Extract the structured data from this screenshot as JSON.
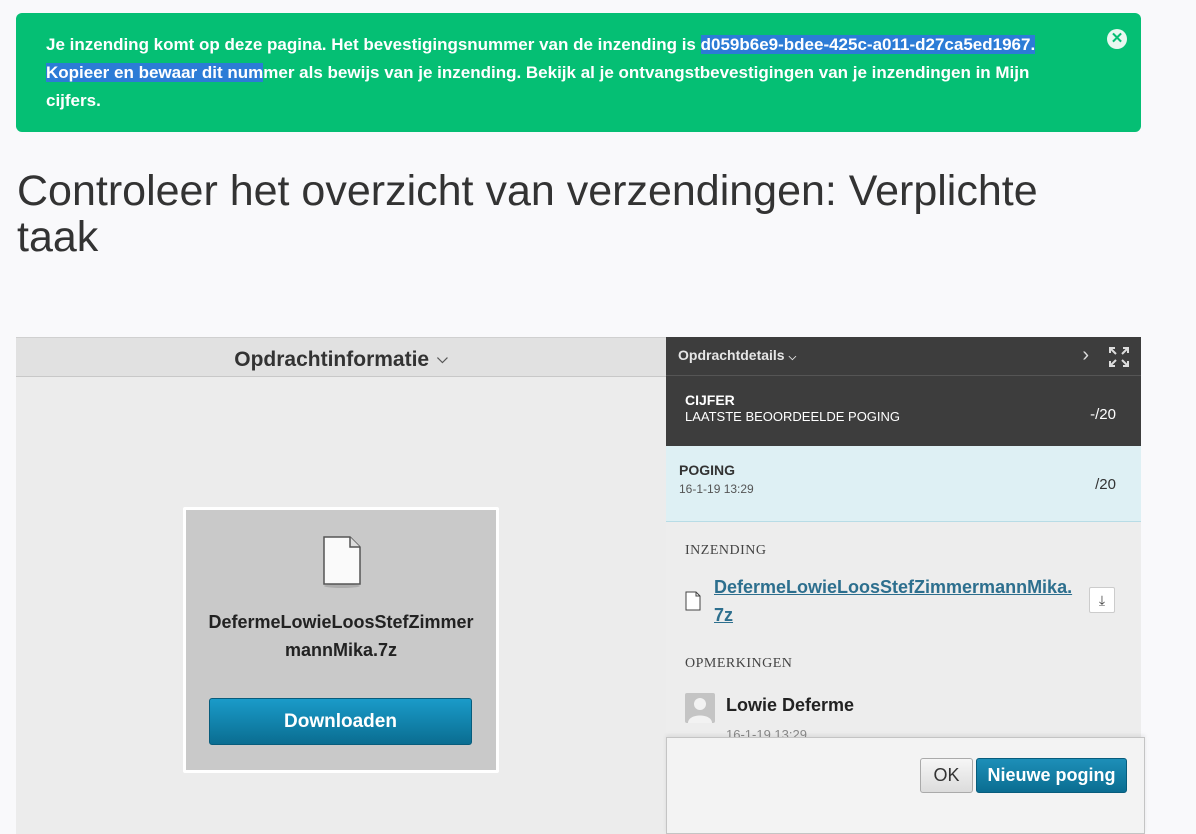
{
  "alert": {
    "text_before": "Je inzending komt op deze pagina. Het bevestigingsnummer van de inzending is ",
    "highlighted": "d059b6e9-bdee-425c-a011-d27ca5ed1967. Kopieer en bewaar dit num",
    "text_after": "mer als bewijs van je inzending. Bekijk al je ontvangstbevestigingen van je inzendingen in Mijn cijfers.",
    "close_glyph": "✕",
    "color": "#05bf74"
  },
  "page_title": "Controleer het overzicht van verzendingen: Verplichte taak",
  "left": {
    "header": "Opdrachtinformatie",
    "file_name": "DefermeLowieLoosStefZimmermannMika.7z",
    "download_label": "Downloaden"
  },
  "right": {
    "header": "Opdrachtdetails",
    "grade": {
      "title": "CIJFER",
      "subtitle": "LAATSTE BEOORDEELDE POGING",
      "score": "-/20"
    },
    "attempt": {
      "title": "POGING",
      "date": "16-1-19 13:29",
      "score": "/20"
    },
    "submission_label": "INZENDING",
    "submission_file": "DefermeLowieLoosStefZimmermannMika.7z",
    "comments_label": "OPMERKINGEN",
    "comment_author": "Lowie Deferme",
    "comment_time": "16-1-19 13:29"
  },
  "footer": {
    "ok_label": "OK",
    "new_attempt_label": "Nieuwe poging"
  }
}
